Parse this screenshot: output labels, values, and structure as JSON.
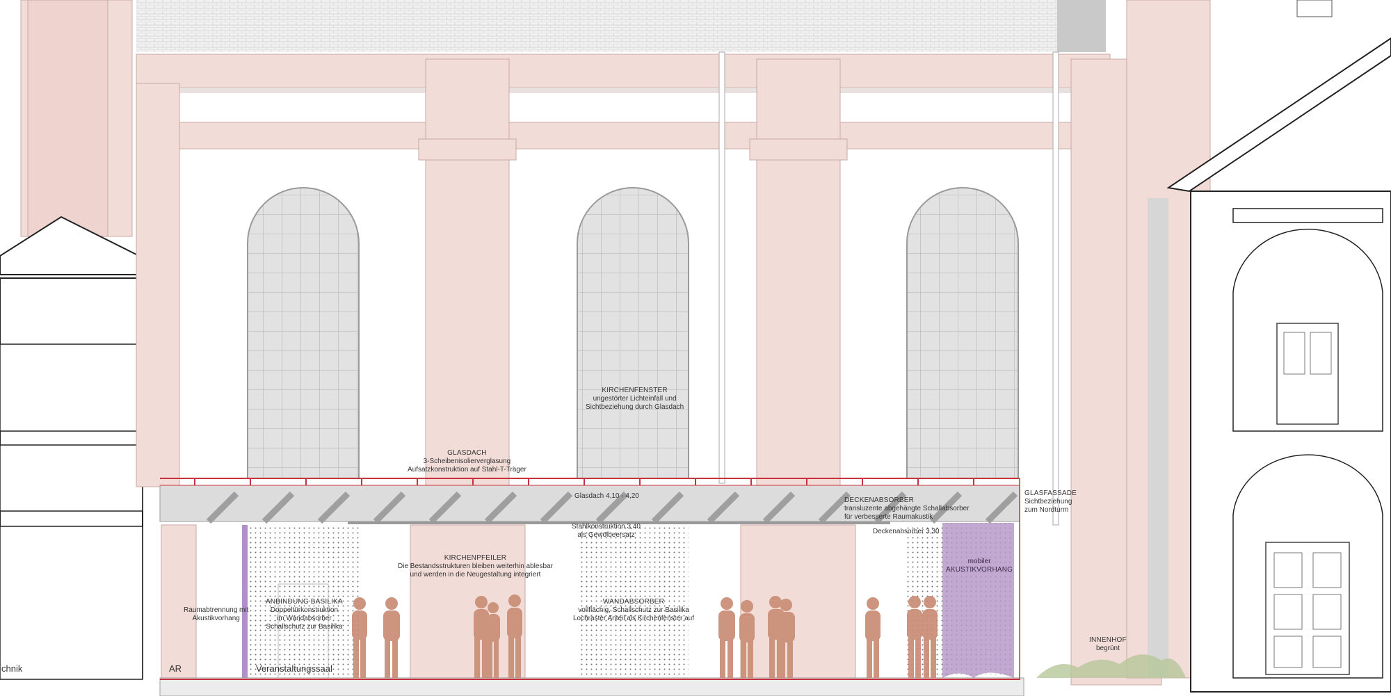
{
  "drawing": {
    "colors": {
      "pier": "#f2dcd8",
      "pier_line": "#c9a7a2",
      "glass_roof": "#dcdcdc",
      "red_line": "#c8323c",
      "people": "#c98d76",
      "curtain": "#b79ac9",
      "curtain_left": "#b28fc8",
      "roof_tiles": "#e9e9e9",
      "greenery": "#b7c79a"
    }
  },
  "labels": {
    "glasdach": {
      "title": "GLASDACH",
      "l1": "3-Scheibenisolierverglasung",
      "l2": "Aufsatzkonstruktion auf Stahl-T-Träger"
    },
    "kirchenfenster": {
      "title": "KIRCHENFENSTER",
      "l1": "ungestörter Lichteinfall und",
      "l2": "Sichtbeziehung durch Glasdach"
    },
    "glasdach_height": "Glasdach 4,10 - 4,20",
    "deckenabsorber": {
      "title": "DECKENABSORBER",
      "l1": "transluzente abgehängte Schallabsorber",
      "l2": "für verbesserte Raumakustik"
    },
    "glasfassade": {
      "title": "GLASFASSADE",
      "l1": "Sichtbeziehung",
      "l2": "zum Nordturm"
    },
    "stahlkonstruktion": {
      "l1": "Stahlkonstruktion 3,40",
      "l2": "als Gewölbeersatz"
    },
    "deckenabsorber_height": "Deckenabsorber 3,30",
    "kirchenpfeiler": {
      "title": "KIRCHENPFEILER",
      "l1": "Die Bestandsstrukturen bleiben weiterhin ablesbar",
      "l2": "und werden in die Neugestaltung integriert"
    },
    "akustikvorhang": {
      "l1": "mobiler",
      "l2": "AKUSTIKVORHANG"
    },
    "raumabtrennung": {
      "l1": "Raumabtrennung mit",
      "l2": "Akustikvorhang"
    },
    "anbindung": {
      "title": "ANBINDUNG BASILIKA",
      "l1": "Doppeltürkonstruktion",
      "l2": "im Wandabsorber",
      "l3": "Schallschutz zur Basilika"
    },
    "wandabsorber": {
      "title": "WANDABSORBER",
      "l1": "vollflächig, Schallschutz zur Basilika",
      "l2": "Lochraster Anteil als Kirchenfenster auf"
    },
    "innenhof": {
      "l1": "INNENHOF",
      "l2": "begrünt"
    }
  },
  "rooms": {
    "technik": "chnik",
    "ar": "AR",
    "saal": "Veranstaltungssaal"
  }
}
